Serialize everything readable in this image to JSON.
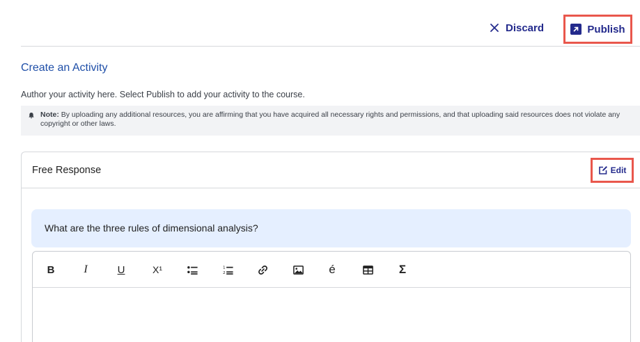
{
  "header": {
    "discard_label": "Discard",
    "publish_label": "Publish"
  },
  "page": {
    "title": "Create an Activity",
    "subtitle": "Author your activity here. Select Publish to add your activity to the course.",
    "note_label": "Note:",
    "note_text": " By uploading any additional resources, you are affirming that you have acquired all necessary rights and permissions, and that uploading said resources does not violate any copyright or other laws."
  },
  "card": {
    "title": "Free Response",
    "edit_label": "Edit",
    "prompt": "What are the three rules of dimensional analysis?"
  },
  "toolbar": {
    "bold": "B",
    "italic": "I",
    "underline": "U",
    "superscript": "X¹",
    "accent": "é",
    "sigma": "Σ"
  },
  "colors": {
    "brand": "#232a8c",
    "title_blue": "#1f4fa8",
    "highlight": "#e9574c",
    "prompt_bg": "#e5efff"
  }
}
